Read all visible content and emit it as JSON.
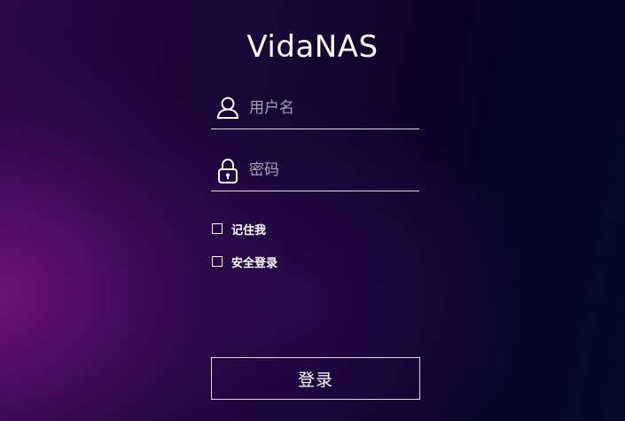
{
  "app": {
    "title": "VidaNAS"
  },
  "login_form": {
    "username": {
      "placeholder": "用户名",
      "value": "",
      "icon": "user-icon"
    },
    "password": {
      "placeholder": "密码",
      "value": "",
      "icon": "lock-icon"
    },
    "remember_me": {
      "label": "记住我",
      "checked": false
    },
    "secure_login": {
      "label": "安全登录",
      "checked": false
    },
    "submit_label": "登录"
  },
  "colors": {
    "text": "#ffffff",
    "background_left": "#5a0f74",
    "background_right": "#030a2a"
  }
}
